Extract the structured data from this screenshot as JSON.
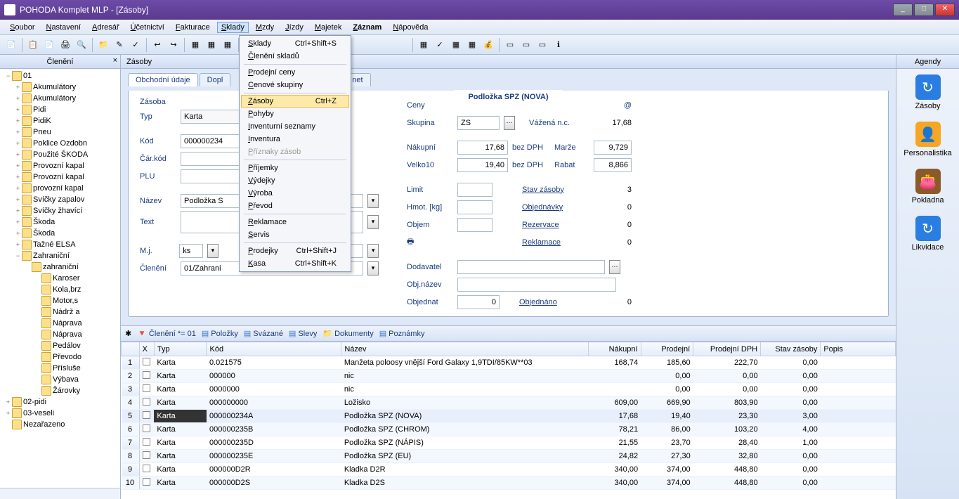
{
  "window": {
    "title": "POHODA Komplet MLP - [Zásoby]"
  },
  "menu": [
    "Soubor",
    "Nastavení",
    "Adresář",
    "Účetnictví",
    "Fakturace",
    "Sklady",
    "Mzdy",
    "Jízdy",
    "Majetek",
    "Záznam",
    "Nápověda"
  ],
  "menu_active_index": 5,
  "dropdown": [
    {
      "label": "Sklady",
      "accel": "Ctrl+Shift+S"
    },
    {
      "label": "Členění skladů"
    },
    {
      "sep": true
    },
    {
      "label": "Prodejní ceny"
    },
    {
      "label": "Cenové skupiny"
    },
    {
      "sep": true
    },
    {
      "label": "Zásoby",
      "accel": "Ctrl+Z",
      "hover": true
    },
    {
      "label": "Pohyby"
    },
    {
      "label": "Inventurní seznamy"
    },
    {
      "label": "Inventura"
    },
    {
      "label": "Příznaky zásob",
      "disabled": true
    },
    {
      "sep": true
    },
    {
      "label": "Příjemky"
    },
    {
      "label": "Výdejky"
    },
    {
      "label": "Výroba"
    },
    {
      "label": "Převod"
    },
    {
      "sep": true
    },
    {
      "label": "Reklamace"
    },
    {
      "label": "Servis"
    },
    {
      "sep": true
    },
    {
      "label": "Prodejky",
      "accel": "Ctrl+Shift+J"
    },
    {
      "label": "Kasa",
      "accel": "Ctrl+Shift+K"
    }
  ],
  "left": {
    "title": "Členění",
    "nodes": [
      {
        "d": 0,
        "e": "−",
        "t": "01"
      },
      {
        "d": 1,
        "e": "+",
        "t": "Akumulátory"
      },
      {
        "d": 1,
        "e": "+",
        "t": "Akumulátory"
      },
      {
        "d": 1,
        "e": "+",
        "t": "Pidi"
      },
      {
        "d": 1,
        "e": "+",
        "t": "PidiK"
      },
      {
        "d": 1,
        "e": "+",
        "t": "Pneu"
      },
      {
        "d": 1,
        "e": "+",
        "t": "Poklice Ozdobn"
      },
      {
        "d": 1,
        "e": "+",
        "t": "Použité ŠKODA"
      },
      {
        "d": 1,
        "e": "+",
        "t": "Provozní kapal"
      },
      {
        "d": 1,
        "e": "+",
        "t": "Provozní kapal"
      },
      {
        "d": 1,
        "e": "+",
        "t": "provozní kapal"
      },
      {
        "d": 1,
        "e": "+",
        "t": "Svíčky zapalov"
      },
      {
        "d": 1,
        "e": "+",
        "t": "Svíčky žhavící"
      },
      {
        "d": 1,
        "e": "+",
        "t": "Škoda"
      },
      {
        "d": 1,
        "e": "+",
        "t": "Škoda"
      },
      {
        "d": 1,
        "e": "+",
        "t": "Tažné ELSA"
      },
      {
        "d": 1,
        "e": "−",
        "t": "Zahraniční"
      },
      {
        "d": 2,
        "e": "",
        "t": "zahraniční"
      },
      {
        "d": 3,
        "e": "",
        "t": "Karoser"
      },
      {
        "d": 3,
        "e": "",
        "t": "Kola,brz"
      },
      {
        "d": 3,
        "e": "",
        "t": "Motor,s"
      },
      {
        "d": 3,
        "e": "",
        "t": "Nádrž a"
      },
      {
        "d": 3,
        "e": "",
        "t": "Náprava"
      },
      {
        "d": 3,
        "e": "",
        "t": "Náprava"
      },
      {
        "d": 3,
        "e": "",
        "t": "Pedálov"
      },
      {
        "d": 3,
        "e": "",
        "t": "Převodo"
      },
      {
        "d": 3,
        "e": "",
        "t": "Přísluše"
      },
      {
        "d": 3,
        "e": "",
        "t": "Výbava"
      },
      {
        "d": 3,
        "e": "",
        "t": "Žárovky"
      },
      {
        "d": 0,
        "e": "+",
        "t": "02-pidi"
      },
      {
        "d": 0,
        "e": "+",
        "t": "03-veseli"
      },
      {
        "d": 0,
        "e": "",
        "t": "Nezařazeno"
      }
    ]
  },
  "center_tab": "Zásoby",
  "subtabs": [
    "Obchodní údaje",
    "Dopl",
    "net"
  ],
  "record_title": "Podložka SPZ (NOVA)",
  "form": {
    "section1": "Zásoba",
    "typ": "Karta",
    "kod": "000000234",
    "carkod": "",
    "plu": "",
    "pct1": "%",
    "pct2": "%",
    "nazev": "Podložka S",
    "text": "",
    "mj": "ks",
    "cleneni": "01/Zahrani",
    "section2": "Ceny",
    "at": "@",
    "skupina": "ZS",
    "vazena_lbl": "Vážená n.c.",
    "vazena": "17,68",
    "nakupni_lbl": "Nákupní",
    "nakupni": "17,68",
    "bezdph": "bez DPH",
    "marze_lbl": "Marže",
    "marze": "9,729",
    "velko_lbl": "Velko10",
    "velko": "19,40",
    "rabat_lbl": "Rabat",
    "rabat": "8,866",
    "limit_lbl": "Limit",
    "stav_lbl": "Stav zásoby",
    "stav": "3",
    "hmot_lbl": "Hmot. [kg]",
    "obj_lbl": "Objednávky",
    "obj": "0",
    "objem_lbl": "Objem",
    "rez_lbl": "Rezervace",
    "rez": "0",
    "rekl_lbl": "Reklamace",
    "rekl": "0",
    "dod_lbl": "Dodavatel",
    "objnazev_lbl": "Obj.název",
    "objednat_lbl": "Objednat",
    "objednat": "0",
    "objednano_lbl": "Objednáno",
    "objednano": "0"
  },
  "gridtabs": {
    "filter": "Členění *= 01",
    "tabs": [
      "Položky",
      "Svázané",
      "Slevy",
      "Dokumenty",
      "Poznámky"
    ]
  },
  "grid": {
    "cols": [
      "",
      "X",
      "Typ",
      "Kód",
      "Název",
      "Nákupní",
      "Prodejní",
      "Prodejní DPH",
      "Stav zásoby",
      "Popis"
    ],
    "rows": [
      {
        "n": 1,
        "typ": "Karta",
        "kod": "0.021575",
        "nazev": "Manžeta poloosy vnější Ford Galaxy 1,9TDI/85KW**03",
        "nak": "168,74",
        "pro": "185,60",
        "dph": "222,70",
        "stav": "0,00"
      },
      {
        "n": 2,
        "typ": "Karta",
        "kod": "000000",
        "nazev": "nic",
        "nak": "",
        "pro": "0,00",
        "dph": "0,00",
        "stav": "0,00"
      },
      {
        "n": 3,
        "typ": "Karta",
        "kod": "0000000",
        "nazev": "nic",
        "nak": "",
        "pro": "0,00",
        "dph": "0,00",
        "stav": "0,00"
      },
      {
        "n": 4,
        "typ": "Karta",
        "kod": "000000000",
        "nazev": "Ložisko",
        "nak": "609,00",
        "pro": "669,90",
        "dph": "803,90",
        "stav": "0,00"
      },
      {
        "n": 5,
        "typ": "Karta",
        "kod": "000000234A",
        "nazev": "Podložka SPZ (NOVA)",
        "nak": "17,68",
        "pro": "19,40",
        "dph": "23,30",
        "stav": "3,00",
        "sel": true
      },
      {
        "n": 6,
        "typ": "Karta",
        "kod": "000000235B",
        "nazev": "Podložka SPZ (CHROM)",
        "nak": "78,21",
        "pro": "86,00",
        "dph": "103,20",
        "stav": "4,00"
      },
      {
        "n": 7,
        "typ": "Karta",
        "kod": "000000235D",
        "nazev": "Podložka SPZ (NÁPIS)",
        "nak": "21,55",
        "pro": "23,70",
        "dph": "28,40",
        "stav": "1,00"
      },
      {
        "n": 8,
        "typ": "Karta",
        "kod": "000000235E",
        "nazev": "Podložka SPZ (EU)",
        "nak": "24,82",
        "pro": "27,30",
        "dph": "32,80",
        "stav": "0,00"
      },
      {
        "n": 9,
        "typ": "Karta",
        "kod": "000000D2R",
        "nazev": "Kladka D2R",
        "nak": "340,00",
        "pro": "374,00",
        "dph": "448,80",
        "stav": "0,00"
      },
      {
        "n": 10,
        "typ": "Karta",
        "kod": "000000D2S",
        "nazev": "Kladka D2S",
        "nak": "340,00",
        "pro": "374,00",
        "dph": "448,80",
        "stav": "0,00"
      }
    ]
  },
  "right": {
    "title": "Agendy",
    "items": [
      {
        "label": "Zásoby",
        "color": "#2a7de1",
        "glyph": "↻"
      },
      {
        "label": "Personalistika",
        "color": "#f6a623",
        "glyph": "👤"
      },
      {
        "label": "Pokladna",
        "color": "#8a5a2a",
        "glyph": "👛"
      },
      {
        "label": "Likvidace",
        "color": "#2a7de1",
        "glyph": "↻"
      }
    ]
  }
}
